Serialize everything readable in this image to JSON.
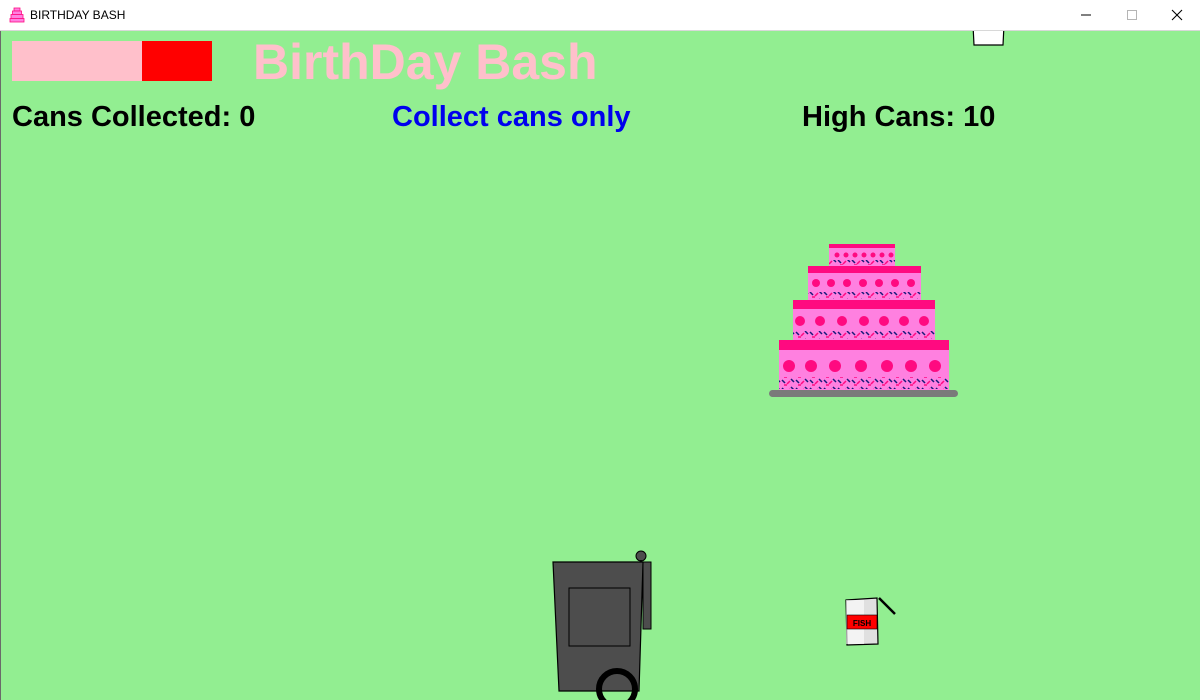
{
  "window": {
    "title": "BIRTHDAY BASH",
    "icon": "cake-icon",
    "controls": [
      "minimize-icon",
      "maximize-icon",
      "close-icon"
    ]
  },
  "hud": {
    "game_title": "BirthDay Bash",
    "cans_collected_label": "Cans Collected: 0",
    "cans_collected": 0,
    "instruction": "Collect cans only",
    "high_cans_label": "High Cans: 10",
    "high_cans": 10,
    "health_fill_fraction": 0.35
  },
  "sprites": {
    "fish_can_label": "FISH"
  },
  "colors": {
    "background": "#92ee91",
    "title": "#ffc0cb",
    "instruction": "#0000ee",
    "hud_text": "#000000",
    "health_empty": "#ffc0cb",
    "health_fill": "#ff0000",
    "cake_body": "#ff80e0",
    "cake_frosting": "#ff0a80",
    "bin": "#4d4d4d"
  }
}
